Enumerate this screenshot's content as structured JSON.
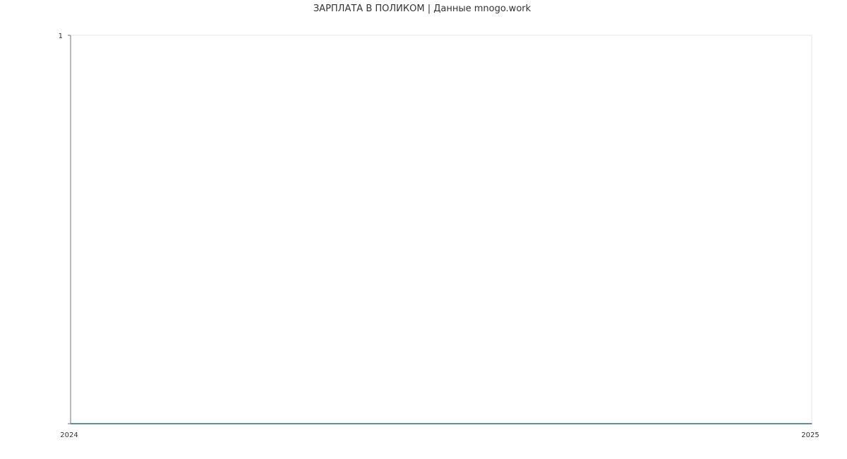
{
  "chart_data": {
    "type": "line",
    "title": "ЗАРПЛАТА В ПОЛИКОМ | Данные mnogo.work",
    "xlabel": "",
    "ylabel": "",
    "x_ticks": [
      "2024",
      "2025"
    ],
    "y_ticks": [
      "1"
    ],
    "xlim": [
      2024,
      2025
    ],
    "ylim": [
      0,
      1
    ],
    "grid": false,
    "legend": "none",
    "series": [
      {
        "x": [
          2024,
          2025
        ],
        "values": [
          0,
          0
        ],
        "color": "#5f8fa8"
      }
    ],
    "colors": {
      "axis": "#6b7280",
      "frame": "#e5e5e5",
      "series": "#5f8fa8",
      "text": "#333333"
    }
  }
}
